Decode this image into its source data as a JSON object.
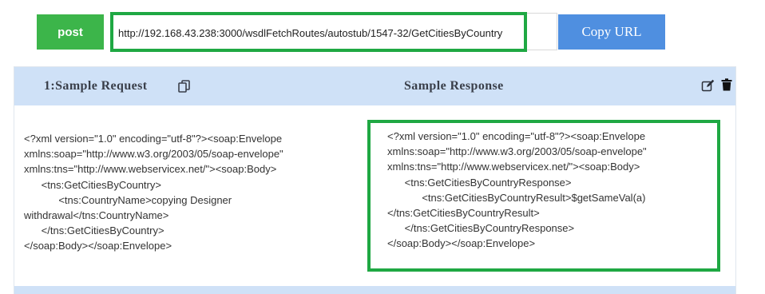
{
  "toolbar": {
    "method_label": "post",
    "url_value": "http://192.168.43.238:3000/wsdlFetchRoutes/autostub/1547-32/GetCitiesByCountry",
    "copy_url_label": "Copy URL"
  },
  "panel": {
    "request_title": "1:Sample Request",
    "response_title": "Sample Response",
    "request_xml": "<?xml version=\"1.0\" encoding=\"utf-8\"?><soap:Envelope\nxmlns:soap=\"http://www.w3.org/2003/05/soap-envelope\"\nxmlns:tns=\"http://www.webservicex.net/\"><soap:Body>\n      <tns:GetCitiesByCountry>\n            <tns:CountryName>copying Designer\nwithdrawal</tns:CountryName>\n      </tns:GetCitiesByCountry>\n</soap:Body></soap:Envelope>",
    "response_xml": "<?xml version=\"1.0\" encoding=\"utf-8\"?><soap:Envelope\nxmlns:soap=\"http://www.w3.org/2003/05/soap-envelope\"\nxmlns:tns=\"http://www.webservicex.net/\"><soap:Body>\n      <tns:GetCitiesByCountryResponse>\n            <tns:GetCitiesByCountryResult>$getSameVal(a)\n</tns:GetCitiesByCountryResult>\n      </tns:GetCitiesByCountryResponse>\n</soap:Body></soap:Envelope>"
  },
  "icons": {
    "copy": "copy-icon",
    "edit": "edit-icon",
    "delete": "trash-icon"
  },
  "colors": {
    "method_button": "#3cb54a",
    "copy_button": "#4f8fe0",
    "highlight": "#1fa843",
    "panel_header": "#cfe1f7"
  }
}
